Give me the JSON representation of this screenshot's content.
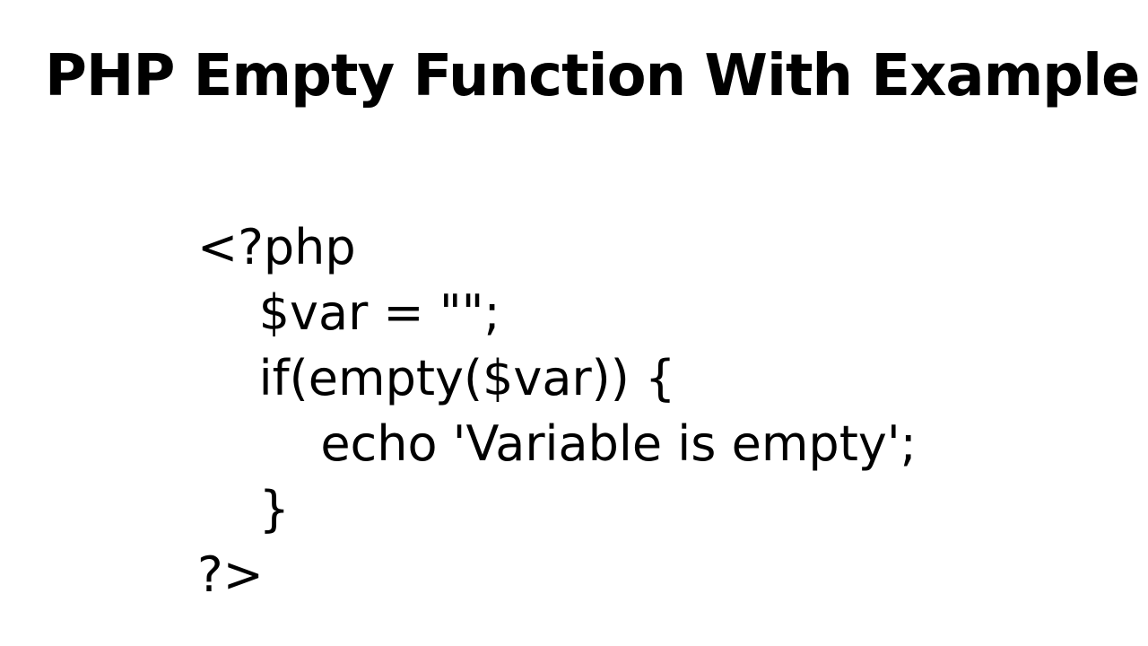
{
  "title": "PHP Empty Function With Example",
  "code": {
    "line1": "<?php",
    "line2": "    $var = \"\";",
    "line3": "    if(empty($var)) {",
    "line4": "        echo 'Variable is empty';",
    "line5": "    }",
    "line6": "?>"
  }
}
